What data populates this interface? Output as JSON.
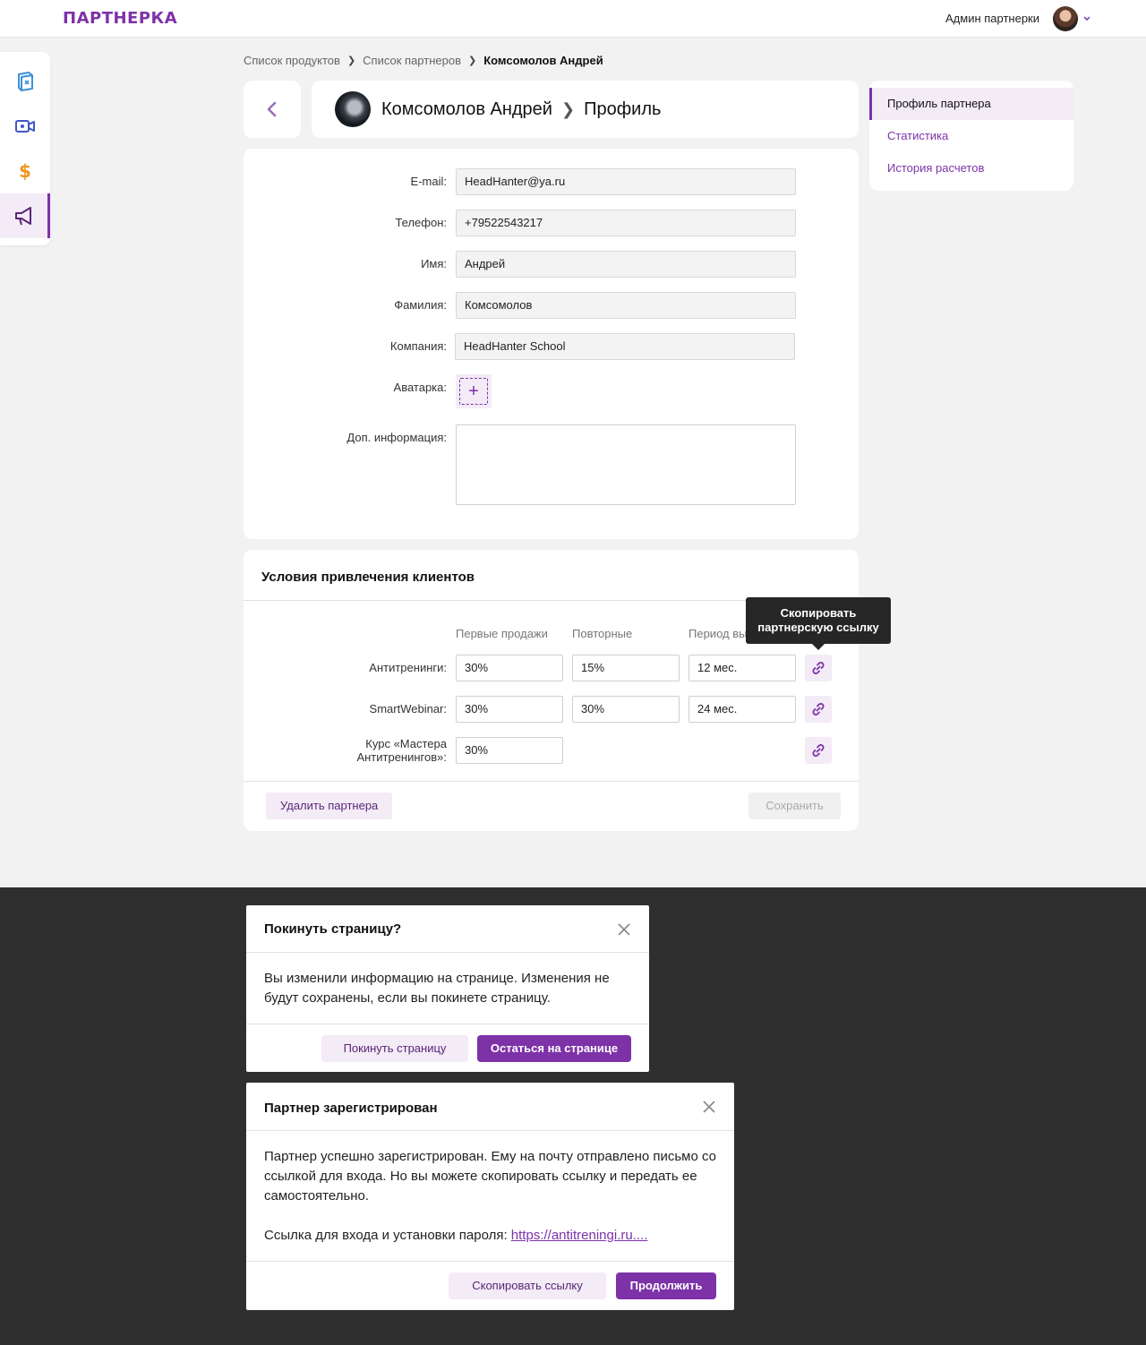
{
  "header": {
    "logo": "ПАРТНЕРКА",
    "user_name": "Админ партнерки"
  },
  "sidebar": {
    "items": [
      {
        "icon": "book-icon",
        "color": "#3b8fd9"
      },
      {
        "icon": "video-camera-icon",
        "color": "#4156c4"
      },
      {
        "icon": "dollar-icon",
        "color": "#f0961e"
      },
      {
        "icon": "megaphone-icon",
        "color": "#7d32a8",
        "active": true
      }
    ]
  },
  "breadcrumb": {
    "items": [
      "Список продуктов",
      "Список партнеров"
    ],
    "current": "Комсомолов Андрей"
  },
  "title": {
    "name": "Комсомолов Андрей",
    "section": "Профиль"
  },
  "right_menu": {
    "items": [
      "Профиль партнера",
      "Статистика",
      "История расчетов"
    ]
  },
  "form": {
    "email_label": "E-mail:",
    "email": "HeadHanter@ya.ru",
    "phone_label": "Телефон:",
    "phone": "+79522543217",
    "name_label": "Имя:",
    "name": "Андрей",
    "surname_label": "Фамилия:",
    "surname": "Комсомолов",
    "company_label": "Компания:",
    "company": "HeadHanter School",
    "avatar_label": "Аватарка:",
    "info_label": "Доп. информация:"
  },
  "conditions": {
    "title": "Условия привлечения клиентов",
    "columns": [
      "Первые продажи",
      "Повторные",
      "Период выпл"
    ],
    "rows": [
      {
        "label": "Антитренинги:",
        "first": "30%",
        "repeat": "15%",
        "period": "12 мес."
      },
      {
        "label": "SmartWebinar:",
        "first": "30%",
        "repeat": "30%",
        "period": "24 мес."
      },
      {
        "label_line1": "Курс «Мастера",
        "label_line2": "Антитренингов»:",
        "first": "30%"
      }
    ],
    "tooltip_line1": "Скопировать",
    "tooltip_line2": "партнерскую ссылку",
    "delete_button": "Удалить партнера",
    "save_button": "Сохранить"
  },
  "modal_leave": {
    "title": "Покинуть страницу?",
    "body": "Вы изменили информацию на странице. Изменения не будут сохранены, если вы покинете страницу.",
    "leave_button": "Покинуть страницу",
    "stay_button": "Остаться на странице"
  },
  "modal_registered": {
    "title": "Партнер зарегистрирован",
    "body": "Партнер успешно зарегистрирован. Ему на почту отправлено письмо со ссылкой для входа. Но вы можете скопировать ссылку и передать ее самостоятельно.",
    "link_label": "Ссылка для входа и установки пароля:",
    "link": "https://antitreningi.ru....",
    "copy_button": "Скопировать ссылку",
    "continue_button": "Продолжить"
  },
  "colors": {
    "accent": "#7d32a8",
    "accent_light": "#f3ebf6",
    "page_bg": "#f2f2f2",
    "overlay": "#2f2f2f"
  }
}
